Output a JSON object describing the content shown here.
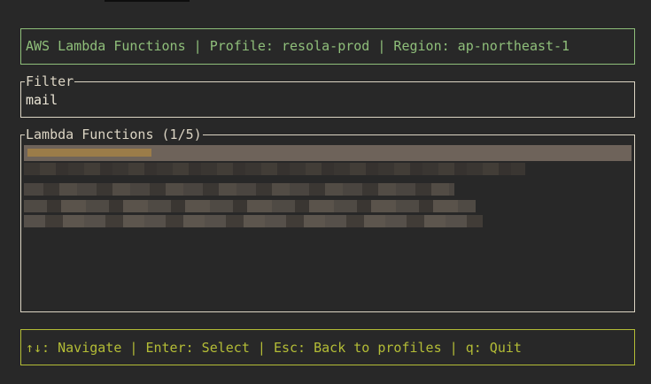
{
  "header": {
    "text": "AWS Lambda Functions | Profile: resola-prod | Region: ap-northeast-1"
  },
  "filter": {
    "title": "Filter",
    "value": "mail"
  },
  "list": {
    "title": "Lambda Functions (1/5)",
    "selected_index": 0
  },
  "footer": {
    "text": "↑↓: Navigate | Enter: Select | Esc: Back to profiles | q: Quit"
  },
  "colors": {
    "background": "#282828",
    "header_border": "#8fbf7a",
    "panel_border": "#dcd5c4",
    "footer_accent": "#b4bd36",
    "selection": "#6e635a"
  }
}
